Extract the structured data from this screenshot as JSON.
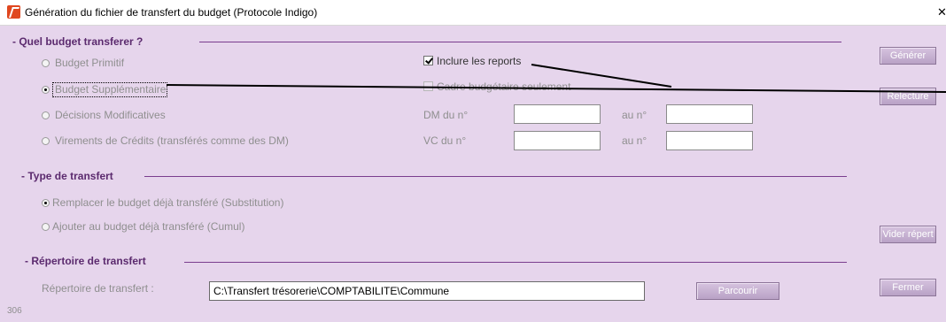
{
  "window": {
    "title": "Génération du fichier de transfert du budget (Protocole Indigo)",
    "close_glyph": "✕"
  },
  "section_budget": {
    "title": "- Quel budget transferer ?",
    "options": [
      {
        "label": "Budget Primitif",
        "selected": false
      },
      {
        "label": "Budget Supplémentaire",
        "selected": true
      },
      {
        "label": "Décisions Modificatives",
        "selected": false
      },
      {
        "label": "Virements de Crédits (transférés comme des DM)",
        "selected": false
      }
    ],
    "include_reports": {
      "label": "Inclure les reports",
      "checked": true
    },
    "cadre_budgetaire": {
      "label": "Cadre budgétaire seulement",
      "checked": false
    },
    "dm_from_label": "DM du n°",
    "dm_from_value": "",
    "dm_to_label": "au n°",
    "dm_to_value": "",
    "vc_from_label": "VC du n°",
    "vc_from_value": "",
    "vc_to_label": "au n°",
    "vc_to_value": ""
  },
  "section_type": {
    "title": "- Type de transfert",
    "options": [
      {
        "label": "Remplacer le budget déjà transféré (Substitution)",
        "selected": true
      },
      {
        "label": "Ajouter au budget déjà transféré (Cumul)",
        "selected": false
      }
    ]
  },
  "section_dir": {
    "title": "- Répertoire de transfert",
    "field_label": "Répertoire de transfert :",
    "path_value": "C:\\Transfert trésorerie\\COMPTABILITE\\Commune"
  },
  "buttons": {
    "generate": "Générer",
    "reread": "Relecture",
    "clear_dir": "Vider répert",
    "browse": "Parcourir",
    "close": "Fermer"
  },
  "status_code": "306",
  "colors": {
    "background": "#e6d5ec",
    "section_title": "#5b2a6e",
    "disabled_text": "#8f8f8f",
    "button": "#b9a2c6"
  }
}
